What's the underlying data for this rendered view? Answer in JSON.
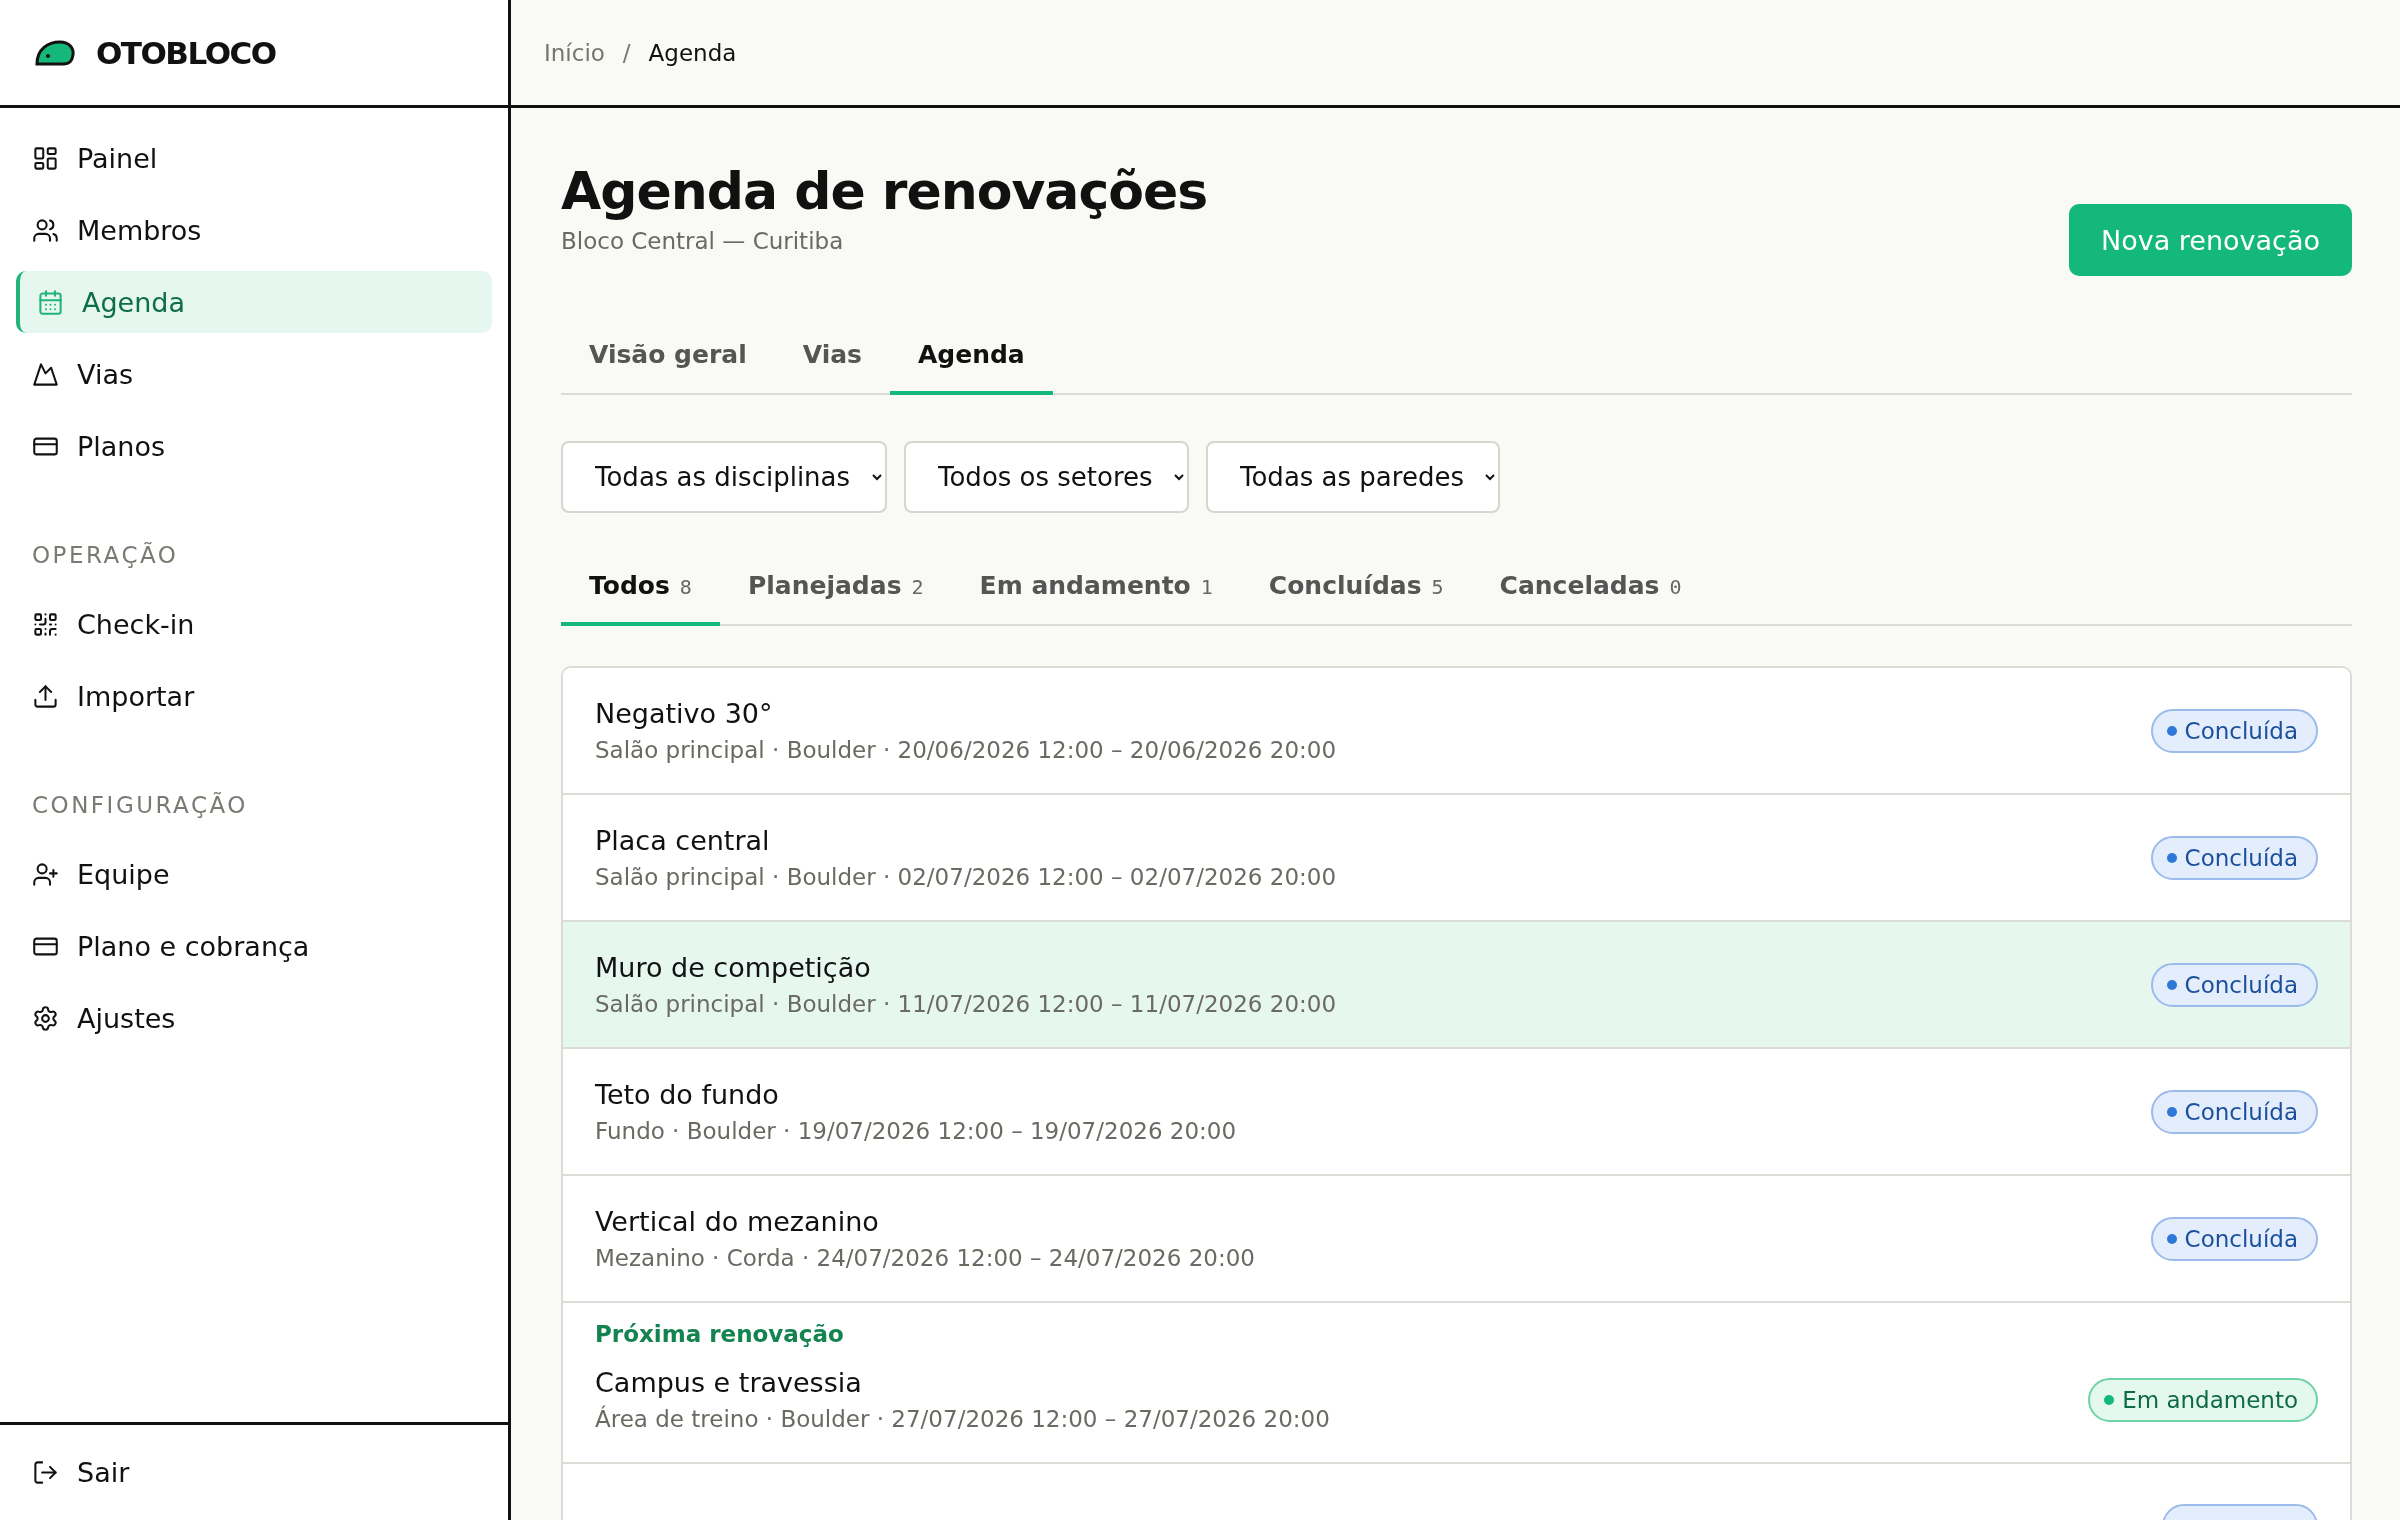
{
  "brand": {
    "name": "OTOBLOCO"
  },
  "sidebar": {
    "sections": [
      {
        "items": [
          {
            "label": "Painel",
            "selected": false
          },
          {
            "label": "Membros",
            "selected": false
          },
          {
            "label": "Agenda",
            "selected": true
          },
          {
            "label": "Vias",
            "selected": false
          },
          {
            "label": "Planos",
            "selected": false
          }
        ]
      },
      {
        "heading": "OPERAÇÃO",
        "items": [
          {
            "label": "Check-in",
            "selected": false
          },
          {
            "label": "Importar",
            "selected": false
          }
        ]
      },
      {
        "heading": "CONFIGURAÇÃO",
        "items": [
          {
            "label": "Equipe",
            "selected": false
          },
          {
            "label": "Plano e cobrança",
            "selected": false
          },
          {
            "label": "Ajustes",
            "selected": false
          }
        ]
      }
    ],
    "footer": {
      "label": "Sair"
    }
  },
  "breadcrumb": {
    "separator": "/",
    "items": [
      "Início",
      "Agenda"
    ]
  },
  "page": {
    "title": "Agenda de renovações",
    "subtitle": "Bloco Central — Curitiba",
    "action": "Nova renovação"
  },
  "tabs": [
    {
      "label": "Visão geral",
      "selected": false
    },
    {
      "label": "Vias",
      "selected": false
    },
    {
      "label": "Agenda",
      "selected": true
    }
  ],
  "filters": [
    {
      "value": "Todas as disciplinas"
    },
    {
      "value": "Todos os setores"
    },
    {
      "value": "Todas as paredes"
    }
  ],
  "status_tabs": [
    {
      "label": "Todos",
      "count": "8",
      "selected": true
    },
    {
      "label": "Planejadas",
      "count": "2",
      "selected": false
    },
    {
      "label": "Em andamento",
      "count": "1",
      "selected": false
    },
    {
      "label": "Concluídas",
      "count": "5",
      "selected": false
    },
    {
      "label": "Canceladas",
      "count": "0",
      "selected": false
    }
  ],
  "list": [
    {
      "kind": "row",
      "title": "Negativo 30°",
      "meta": "Salão principal · Boulder · 20/06/2026 12:00 – 20/06/2026 20:00",
      "highlighted": false,
      "status": {
        "kind": "done",
        "label": "Concluída"
      }
    },
    {
      "kind": "row",
      "title": "Placa central",
      "meta": "Salão principal · Boulder · 02/07/2026 12:00 – 02/07/2026 20:00",
      "highlighted": false,
      "status": {
        "kind": "done",
        "label": "Concluída"
      }
    },
    {
      "kind": "row",
      "title": "Muro de competição",
      "meta": "Salão principal · Boulder · 11/07/2026 12:00 – 11/07/2026 20:00",
      "highlighted": true,
      "status": {
        "kind": "done",
        "label": "Concluída"
      }
    },
    {
      "kind": "row",
      "title": "Teto do fundo",
      "meta": "Fundo · Boulder · 19/07/2026 12:00 – 19/07/2026 20:00",
      "highlighted": false,
      "status": {
        "kind": "done",
        "label": "Concluída"
      }
    },
    {
      "kind": "row",
      "title": "Vertical do mezanino",
      "meta": "Mezanino · Corda · 24/07/2026 12:00 – 24/07/2026 20:00",
      "highlighted": false,
      "status": {
        "kind": "done",
        "label": "Concluída"
      }
    },
    {
      "kind": "heading",
      "label": "Próxima renovação"
    },
    {
      "kind": "row",
      "title": "Campus e travessia",
      "meta": "Área de treino · Boulder · 27/07/2026 12:00 – 27/07/2026 20:00",
      "highlighted": false,
      "status": {
        "kind": "active",
        "label": "Em andamento"
      }
    },
    {
      "kind": "row",
      "highlighted": false,
      "status": {
        "kind": "done"
      }
    }
  ]
}
